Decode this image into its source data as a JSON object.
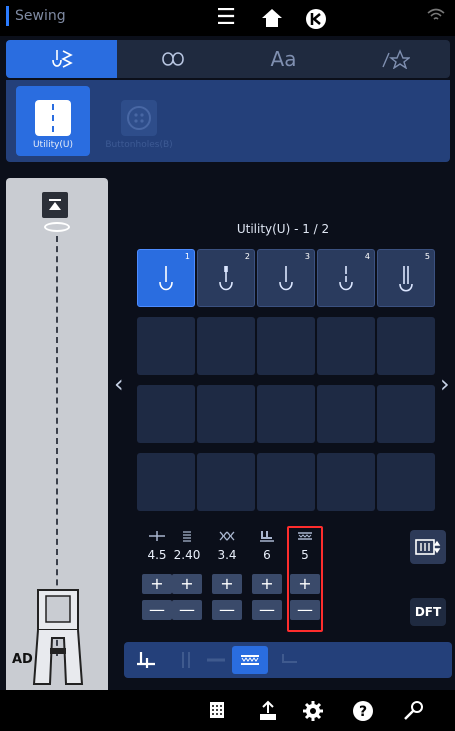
{
  "topbar": {
    "mode_label": "Sewing",
    "menu_icon": "hamburger-menu-icon",
    "home_icon": "home-icon",
    "back_icon": "back-circle-icon",
    "wifi_icon": "wifi-icon"
  },
  "tabs": [
    {
      "id": "utility-stitches",
      "icon": "stitch-tab-icon",
      "active": true
    },
    {
      "id": "embroidery",
      "icon": "embroidery-icon",
      "active": false
    },
    {
      "id": "alphabets",
      "label": "Aa",
      "active": false
    },
    {
      "id": "favorites",
      "icon": "favorites-icon",
      "active": false
    }
  ],
  "subtabs": [
    {
      "label": "Utility(U)",
      "active": true
    },
    {
      "label": "Buttonholes(B)",
      "active": false
    }
  ],
  "page_title": "Utility(U) - 1 / 2",
  "stitches": [
    {
      "num": "1",
      "active": true
    },
    {
      "num": "2",
      "active": false
    },
    {
      "num": "3",
      "active": false
    },
    {
      "num": "4",
      "active": false
    },
    {
      "num": "5",
      "active": false
    }
  ],
  "adjustments": [
    {
      "icon": "stitch-width-icon",
      "value": "4.5",
      "plus": "+",
      "minus": "—"
    },
    {
      "icon": "stitch-length-icon",
      "value": "2.40",
      "plus": "+",
      "minus": "—"
    },
    {
      "icon": "thread-tension-icon",
      "value": "3.4",
      "plus": "+",
      "minus": "—"
    },
    {
      "icon": "presser-foot-pressure-icon",
      "value": "6",
      "plus": "+",
      "minus": "—"
    },
    {
      "icon": "feed-dog-icon",
      "value": "5",
      "plus": "+",
      "minus": "—"
    }
  ],
  "side_button_icon": "stitch-settings-icon",
  "dft_label": "DFT",
  "preview": {
    "foot_label": "AD"
  },
  "nav": {
    "left_arrow": "‹",
    "right_arrow": "›"
  },
  "colors": {
    "accent": "#2a6de0",
    "highlight": "#ff2d2d"
  },
  "bottomnav_icons": [
    "stitch-memory-icon",
    "export-icon",
    "settings-gear-icon",
    "help-icon",
    "tools-icon"
  ]
}
